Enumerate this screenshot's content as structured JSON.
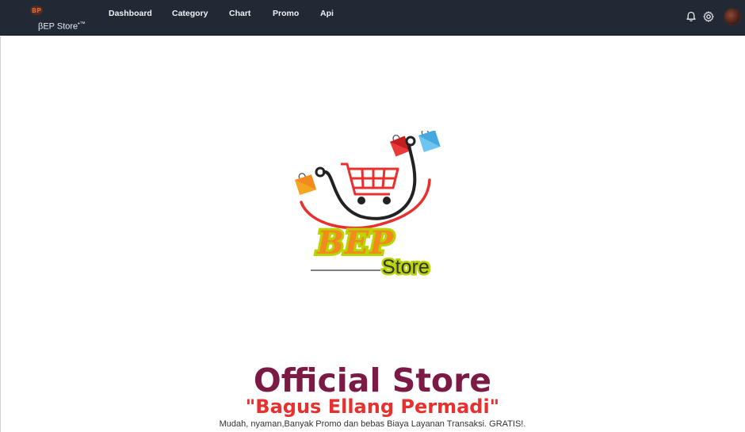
{
  "navbar": {
    "brand": "βEP Store",
    "brand_suffix": "•™",
    "menu": [
      {
        "label": "Dashboard"
      },
      {
        "label": "Category"
      },
      {
        "label": "Chart"
      },
      {
        "label": "Promo"
      },
      {
        "label": "Api"
      }
    ],
    "icons": [
      "bell-icon",
      "gear-icon",
      "avatar"
    ]
  },
  "logo": {
    "primary_text": "BEP",
    "secondary_text": "Store"
  },
  "hero": {
    "title": "Official Store",
    "subtitle": "\"Bagus Ellang Permadi\"",
    "description": "Mudah, nyaman,Banyak Promo dan bebas Biaya Layanan Transaksi. GRATIS!."
  },
  "colors": {
    "navbar_bg": "#212935",
    "title": "#7a1a45",
    "subtitle": "#e8302e",
    "logo_yellow": "#b9d400",
    "logo_orange": "#f28a1e",
    "cart_red": "#e8302e"
  }
}
